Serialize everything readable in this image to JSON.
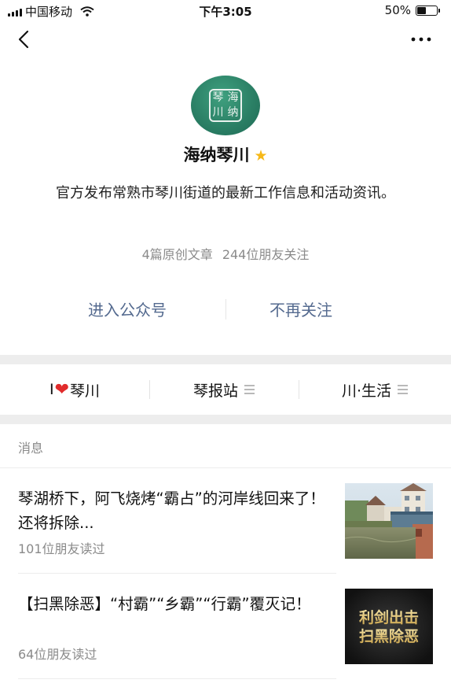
{
  "status_bar": {
    "carrier": "中国移动",
    "time": "下午3:05",
    "battery_text": "50%",
    "battery_level": 0.5
  },
  "nav": {
    "back_icon": "chevron-left-icon",
    "more_icon": "more-dots-icon"
  },
  "profile": {
    "avatar_chars": [
      "琴",
      "海",
      "川",
      "纳"
    ],
    "name": "海纳琴川",
    "verified_icon": "star-icon",
    "description": "官方发布常熟市琴川街道的最新工作信息和活动资讯。",
    "original_articles": "4篇原创文章",
    "followers": "244位朋友关注"
  },
  "actions": {
    "enter": "进入公众号",
    "unfollow": "不再关注"
  },
  "menu": {
    "item1_prefix": "I",
    "item1_suffix": "琴川",
    "item2": "琴报站",
    "item3": "川·生活"
  },
  "messages": {
    "section_label": "消息",
    "items": [
      {
        "title": "琴湖桥下，阿飞烧烤“霸占”的河岸线回来了！还将拆除...",
        "reads": "101位朋友读过"
      },
      {
        "title": "【扫黑除恶】“村霸”“乡霸”“行霸”覆灭记！",
        "reads": "64位朋友读过",
        "thumb_text_1": "利剑出击",
        "thumb_text_2": "扫黑除恶"
      }
    ]
  },
  "colors": {
    "link_blue": "#546a8f",
    "gray_text": "#8a8a8a",
    "divider": "#ededed",
    "star": "#f6b818",
    "heart": "#e12b2b",
    "avatar_green": "#2a7e64"
  }
}
